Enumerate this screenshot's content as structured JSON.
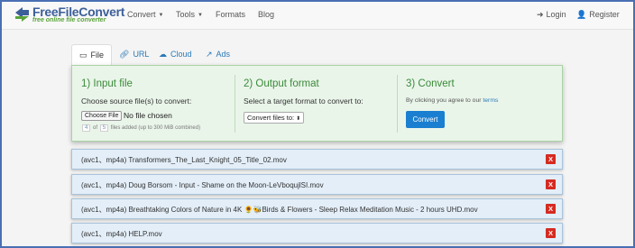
{
  "brand": {
    "name": "FreeFileConvert",
    "tagline": "free online file converter"
  },
  "nav": {
    "convert": "Convert",
    "tools": "Tools",
    "formats": "Formats",
    "blog": "Blog",
    "login": "Login",
    "register": "Register"
  },
  "tabs": {
    "file": "File",
    "url": "URL",
    "cloud": "Cloud",
    "ads": "Ads"
  },
  "panel": {
    "input": {
      "title": "1) Input file",
      "desc": "Choose source file(s) to convert:",
      "choose_button": "Choose File",
      "no_file": "No file chosen",
      "count_added": "4",
      "of": "of",
      "count_total": "5",
      "files_added_note": "files added (up to 300 MiB combined)"
    },
    "output": {
      "title": "2) Output format",
      "desc": "Select a target format to convert to:",
      "select_value": "Convert files to:"
    },
    "convert": {
      "title": "3) Convert",
      "agree_text": "By clicking you agree to our",
      "terms_link": "terms",
      "button": "Convert"
    }
  },
  "files": [
    {
      "label": "(avc1、mp4a)  Transformers_The_Last_Knight_05_Title_02.mov",
      "delete": "X"
    },
    {
      "label": "(avc1、mp4a)  Doug Borsom - Input - Shame on the Moon-LeVboqujlSI.mov",
      "delete": "X"
    },
    {
      "label": "(avc1、mp4a)  Breathtaking Colors of Nature in 4K 🌻🐝Birds & Flowers - Sleep Relax Meditation Music - 2 hours UHD.mov",
      "delete": "X"
    },
    {
      "label": "(avc1、mp4a)  HELP.mov",
      "delete": "X"
    }
  ],
  "colors": {
    "brand_blue": "#3c5f9a",
    "brand_green": "#5aa33a",
    "panel_green": "#eaf5ea",
    "title_green": "#3a8a3a",
    "convert_blue": "#1a7fd0",
    "row_blue": "#e3eef8",
    "delete_red": "#d52b22"
  },
  "icons": {
    "logo": "convert-arrows-icon",
    "login": "sign-in-icon",
    "register": "user-plus-icon",
    "file_tab": "monitor-icon",
    "url_tab": "link-icon",
    "cloud_tab": "cloud-icon",
    "ads_tab": "external-link-icon",
    "delete": "close-icon"
  }
}
